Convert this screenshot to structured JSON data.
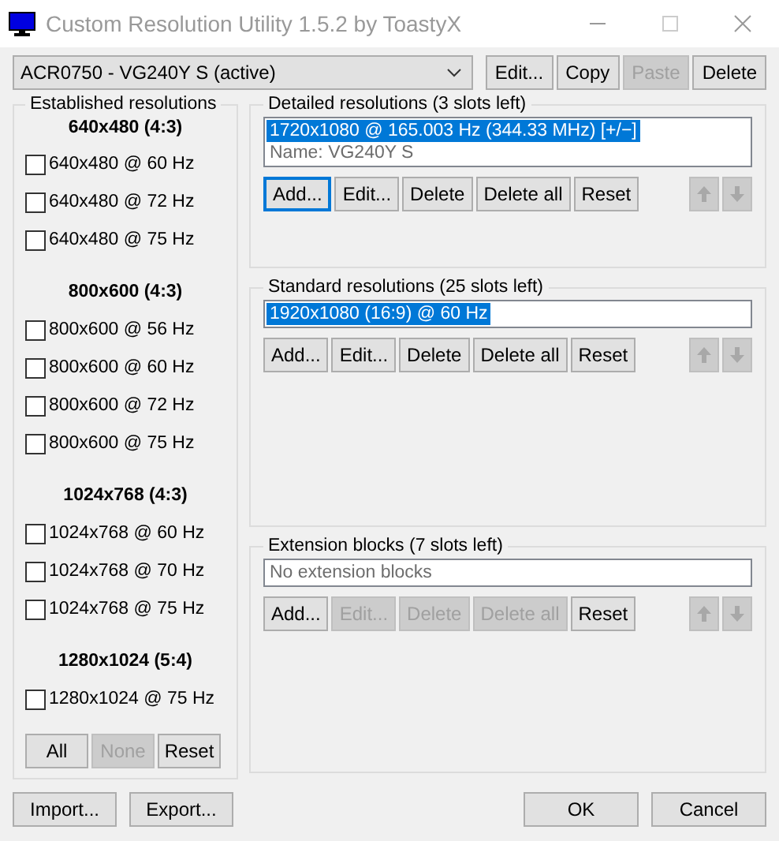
{
  "window": {
    "title": "Custom Resolution Utility 1.5.2 by ToastyX"
  },
  "monitor_select": {
    "value": "ACR0750 - VG240Y S (active)"
  },
  "top_buttons": [
    {
      "label": "Edit...",
      "disabled": false
    },
    {
      "label": "Copy",
      "disabled": false
    },
    {
      "label": "Paste",
      "disabled": true
    },
    {
      "label": "Delete",
      "disabled": false
    }
  ],
  "established": {
    "title": "Established resolutions",
    "groups": [
      {
        "heading": "640x480 (4:3)",
        "items": [
          {
            "label": "640x480 @ 60 Hz",
            "checked": false
          },
          {
            "label": "640x480 @ 72 Hz",
            "checked": false
          },
          {
            "label": "640x480 @ 75 Hz",
            "checked": false
          }
        ]
      },
      {
        "heading": "800x600 (4:3)",
        "items": [
          {
            "label": "800x600 @ 56 Hz",
            "checked": false
          },
          {
            "label": "800x600 @ 60 Hz",
            "checked": false
          },
          {
            "label": "800x600 @ 72 Hz",
            "checked": false
          },
          {
            "label": "800x600 @ 75 Hz",
            "checked": false
          }
        ]
      },
      {
        "heading": "1024x768 (4:3)",
        "items": [
          {
            "label": "1024x768 @ 60 Hz",
            "checked": false
          },
          {
            "label": "1024x768 @ 70 Hz",
            "checked": false
          },
          {
            "label": "1024x768 @ 75 Hz",
            "checked": false
          }
        ]
      },
      {
        "heading": "1280x1024 (5:4)",
        "items": [
          {
            "label": "1280x1024 @ 75 Hz",
            "checked": false
          }
        ]
      }
    ],
    "buttons": [
      {
        "label": "All",
        "disabled": false
      },
      {
        "label": "None",
        "disabled": true
      },
      {
        "label": "Reset",
        "disabled": false
      }
    ]
  },
  "sections": [
    {
      "title": "Detailed resolutions (3 slots left)",
      "rows": [
        {
          "kind": "resolution",
          "text": "1720x1080 @ 165.003 Hz (344.33 MHz) [+/−]",
          "selected": true
        },
        {
          "kind": "note",
          "text": "Name: VG240Y S"
        }
      ],
      "buttons": [
        {
          "label": "Add...",
          "disabled": false,
          "focused": true
        },
        {
          "label": "Edit...",
          "disabled": false,
          "focused": false
        },
        {
          "label": "Delete",
          "disabled": false,
          "focused": false
        },
        {
          "label": "Delete all",
          "disabled": false,
          "focused": false
        },
        {
          "label": "Reset",
          "disabled": false,
          "focused": false
        }
      ],
      "arrows": [
        {
          "kind": "up",
          "disabled": true
        },
        {
          "kind": "down",
          "disabled": true
        }
      ]
    },
    {
      "title": "Standard resolutions (25 slots left)",
      "rows": [
        {
          "kind": "resolution",
          "text": "1920x1080 (16:9) @ 60 Hz",
          "selected": true
        }
      ],
      "buttons": [
        {
          "label": "Add...",
          "disabled": false,
          "focused": false
        },
        {
          "label": "Edit...",
          "disabled": false,
          "focused": false
        },
        {
          "label": "Delete",
          "disabled": false,
          "focused": false
        },
        {
          "label": "Delete all",
          "disabled": false,
          "focused": false
        },
        {
          "label": "Reset",
          "disabled": false,
          "focused": false
        }
      ],
      "arrows": [
        {
          "kind": "up",
          "disabled": true
        },
        {
          "kind": "down",
          "disabled": true
        }
      ]
    },
    {
      "title": "Extension blocks (7 slots left)",
      "rows": [
        {
          "kind": "note",
          "text": "No extension blocks"
        }
      ],
      "buttons": [
        {
          "label": "Add...",
          "disabled": false,
          "focused": false
        },
        {
          "label": "Edit...",
          "disabled": true,
          "focused": false
        },
        {
          "label": "Delete",
          "disabled": true,
          "focused": false
        },
        {
          "label": "Delete all",
          "disabled": true,
          "focused": false
        },
        {
          "label": "Reset",
          "disabled": false,
          "focused": false
        }
      ],
      "arrows": [
        {
          "kind": "up",
          "disabled": true
        },
        {
          "kind": "down",
          "disabled": true
        }
      ]
    }
  ],
  "footer": {
    "left": [
      {
        "label": "Import..."
      },
      {
        "label": "Export..."
      }
    ],
    "right": [
      {
        "label": "OK"
      },
      {
        "label": "Cancel"
      }
    ]
  }
}
